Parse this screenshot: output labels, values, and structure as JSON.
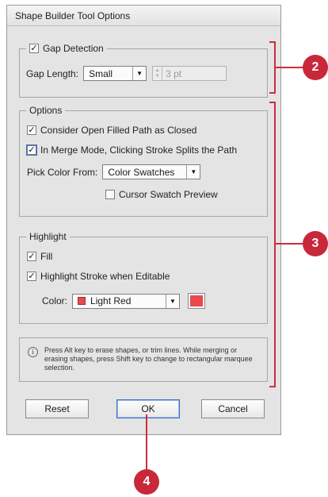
{
  "dialog": {
    "title": "Shape Builder Tool Options",
    "gap_detection": {
      "label": "Gap Detection",
      "checked": true,
      "gap_length_label": "Gap Length:",
      "gap_length_value": "Small",
      "gap_value": "3 pt"
    },
    "options": {
      "label": "Options",
      "consider_open_filled": {
        "label": "Consider Open Filled Path as Closed",
        "checked": true
      },
      "merge_mode_stroke": {
        "label": "In Merge Mode, Clicking Stroke Splits the Path",
        "checked": true
      },
      "pick_color_label": "Pick Color From:",
      "pick_color_value": "Color Swatches",
      "cursor_swatch_preview": {
        "label": "Cursor Swatch Preview",
        "checked": false
      }
    },
    "highlight": {
      "label": "Highlight",
      "fill": {
        "label": "Fill",
        "checked": true
      },
      "stroke_editable": {
        "label": "Highlight Stroke when Editable",
        "checked": true
      },
      "color_label": "Color:",
      "color_value": "Light Red",
      "color_hex": "#e9484c"
    },
    "info": {
      "icon": "info-icon",
      "text": "Press Alt key to erase shapes, or trim lines. While merging or erasing shapes, press Shift key to change to rectangular marquee selection."
    },
    "buttons": {
      "reset": "Reset",
      "ok": "OK",
      "cancel": "Cancel"
    }
  },
  "callouts": [
    {
      "number": "2"
    },
    {
      "number": "3"
    },
    {
      "number": "4"
    }
  ],
  "colors": {
    "callout": "#c9283a",
    "dialog_bg": "#e4e4e4"
  }
}
